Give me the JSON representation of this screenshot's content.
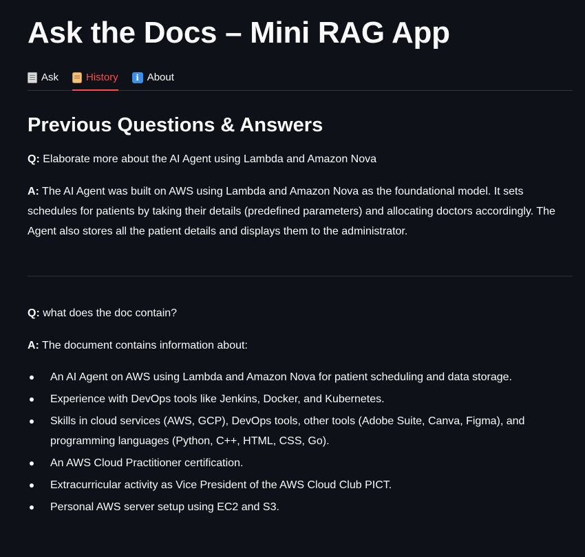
{
  "app": {
    "title": "Ask the Docs – Mini RAG App"
  },
  "tabs": [
    {
      "label": "Ask",
      "icon": "page-icon",
      "active": false
    },
    {
      "label": "History",
      "icon": "scroll-icon",
      "active": true
    },
    {
      "label": "About",
      "icon": "info-icon",
      "active": false
    }
  ],
  "history": {
    "heading": "Previous Questions & Answers",
    "q_prefix": "Q:",
    "a_prefix": "A:",
    "entries": [
      {
        "question": "Elaborate more about the AI Agent using Lambda and Amazon Nova",
        "answer": "The AI Agent was built on AWS using Lambda and Amazon Nova as the foundational model. It sets schedules for patients by taking their details (predefined parameters) and allocating doctors accordingly. The Agent also stores all the patient details and displays them to the administrator."
      },
      {
        "question": "what does the doc contain?",
        "answer": "The document contains information about:",
        "bullets": [
          "An AI Agent on AWS using Lambda and Amazon Nova for patient scheduling and data storage.",
          "Experience with DevOps tools like Jenkins, Docker, and Kubernetes.",
          "Skills in cloud services (AWS, GCP), DevOps tools, other tools (Adobe Suite, Canva, Figma), and programming languages (Python, C++, HTML, CSS, Go).",
          "An AWS Cloud Practitioner certification.",
          "Extracurricular activity as Vice President of the AWS Cloud Club PICT.",
          "Personal AWS server setup using EC2 and S3."
        ]
      }
    ]
  },
  "colors": {
    "background": "#0e1117",
    "text": "#fafafa",
    "accent": "#ff4b4b",
    "divider": "#31333f"
  }
}
